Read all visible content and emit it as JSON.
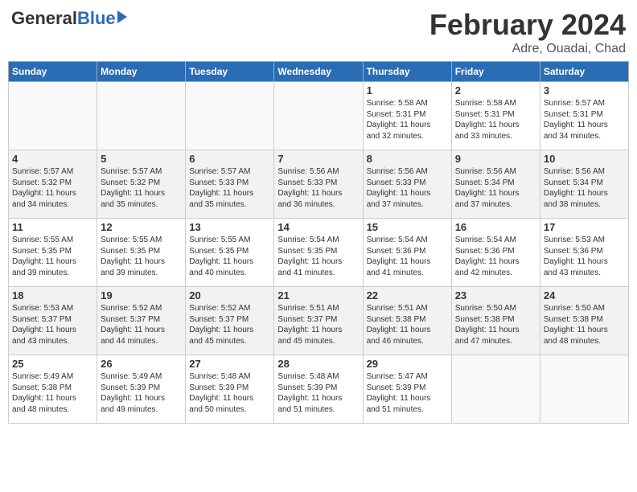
{
  "header": {
    "logo_general": "General",
    "logo_blue": "Blue",
    "month_title": "February 2024",
    "location": "Adre, Ouadai, Chad"
  },
  "days_of_week": [
    "Sunday",
    "Monday",
    "Tuesday",
    "Wednesday",
    "Thursday",
    "Friday",
    "Saturday"
  ],
  "weeks": [
    [
      {
        "day": "",
        "info": ""
      },
      {
        "day": "",
        "info": ""
      },
      {
        "day": "",
        "info": ""
      },
      {
        "day": "",
        "info": ""
      },
      {
        "day": "1",
        "info": "Sunrise: 5:58 AM\nSunset: 5:31 PM\nDaylight: 11 hours\nand 32 minutes."
      },
      {
        "day": "2",
        "info": "Sunrise: 5:58 AM\nSunset: 5:31 PM\nDaylight: 11 hours\nand 33 minutes."
      },
      {
        "day": "3",
        "info": "Sunrise: 5:57 AM\nSunset: 5:31 PM\nDaylight: 11 hours\nand 34 minutes."
      }
    ],
    [
      {
        "day": "4",
        "info": "Sunrise: 5:57 AM\nSunset: 5:32 PM\nDaylight: 11 hours\nand 34 minutes."
      },
      {
        "day": "5",
        "info": "Sunrise: 5:57 AM\nSunset: 5:32 PM\nDaylight: 11 hours\nand 35 minutes."
      },
      {
        "day": "6",
        "info": "Sunrise: 5:57 AM\nSunset: 5:33 PM\nDaylight: 11 hours\nand 35 minutes."
      },
      {
        "day": "7",
        "info": "Sunrise: 5:56 AM\nSunset: 5:33 PM\nDaylight: 11 hours\nand 36 minutes."
      },
      {
        "day": "8",
        "info": "Sunrise: 5:56 AM\nSunset: 5:33 PM\nDaylight: 11 hours\nand 37 minutes."
      },
      {
        "day": "9",
        "info": "Sunrise: 5:56 AM\nSunset: 5:34 PM\nDaylight: 11 hours\nand 37 minutes."
      },
      {
        "day": "10",
        "info": "Sunrise: 5:56 AM\nSunset: 5:34 PM\nDaylight: 11 hours\nand 38 minutes."
      }
    ],
    [
      {
        "day": "11",
        "info": "Sunrise: 5:55 AM\nSunset: 5:35 PM\nDaylight: 11 hours\nand 39 minutes."
      },
      {
        "day": "12",
        "info": "Sunrise: 5:55 AM\nSunset: 5:35 PM\nDaylight: 11 hours\nand 39 minutes."
      },
      {
        "day": "13",
        "info": "Sunrise: 5:55 AM\nSunset: 5:35 PM\nDaylight: 11 hours\nand 40 minutes."
      },
      {
        "day": "14",
        "info": "Sunrise: 5:54 AM\nSunset: 5:35 PM\nDaylight: 11 hours\nand 41 minutes."
      },
      {
        "day": "15",
        "info": "Sunrise: 5:54 AM\nSunset: 5:36 PM\nDaylight: 11 hours\nand 41 minutes."
      },
      {
        "day": "16",
        "info": "Sunrise: 5:54 AM\nSunset: 5:36 PM\nDaylight: 11 hours\nand 42 minutes."
      },
      {
        "day": "17",
        "info": "Sunrise: 5:53 AM\nSunset: 5:36 PM\nDaylight: 11 hours\nand 43 minutes."
      }
    ],
    [
      {
        "day": "18",
        "info": "Sunrise: 5:53 AM\nSunset: 5:37 PM\nDaylight: 11 hours\nand 43 minutes."
      },
      {
        "day": "19",
        "info": "Sunrise: 5:52 AM\nSunset: 5:37 PM\nDaylight: 11 hours\nand 44 minutes."
      },
      {
        "day": "20",
        "info": "Sunrise: 5:52 AM\nSunset: 5:37 PM\nDaylight: 11 hours\nand 45 minutes."
      },
      {
        "day": "21",
        "info": "Sunrise: 5:51 AM\nSunset: 5:37 PM\nDaylight: 11 hours\nand 45 minutes."
      },
      {
        "day": "22",
        "info": "Sunrise: 5:51 AM\nSunset: 5:38 PM\nDaylight: 11 hours\nand 46 minutes."
      },
      {
        "day": "23",
        "info": "Sunrise: 5:50 AM\nSunset: 5:38 PM\nDaylight: 11 hours\nand 47 minutes."
      },
      {
        "day": "24",
        "info": "Sunrise: 5:50 AM\nSunset: 5:38 PM\nDaylight: 11 hours\nand 48 minutes."
      }
    ],
    [
      {
        "day": "25",
        "info": "Sunrise: 5:49 AM\nSunset: 5:38 PM\nDaylight: 11 hours\nand 48 minutes."
      },
      {
        "day": "26",
        "info": "Sunrise: 5:49 AM\nSunset: 5:39 PM\nDaylight: 11 hours\nand 49 minutes."
      },
      {
        "day": "27",
        "info": "Sunrise: 5:48 AM\nSunset: 5:39 PM\nDaylight: 11 hours\nand 50 minutes."
      },
      {
        "day": "28",
        "info": "Sunrise: 5:48 AM\nSunset: 5:39 PM\nDaylight: 11 hours\nand 51 minutes."
      },
      {
        "day": "29",
        "info": "Sunrise: 5:47 AM\nSunset: 5:39 PM\nDaylight: 11 hours\nand 51 minutes."
      },
      {
        "day": "",
        "info": ""
      },
      {
        "day": "",
        "info": ""
      }
    ]
  ]
}
